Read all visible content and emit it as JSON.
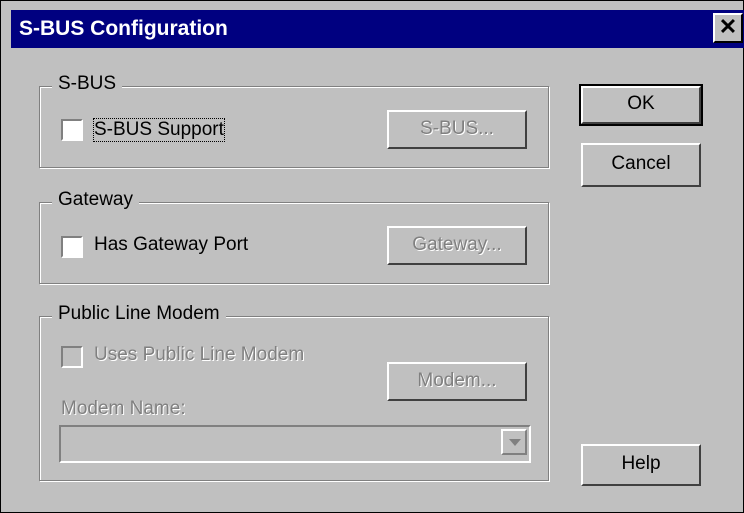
{
  "window": {
    "title": "S-BUS Configuration",
    "close_glyph": "✕"
  },
  "sbus_group": {
    "legend": "S-BUS",
    "checkbox_label": "S-BUS Support",
    "checkbox_checked": false,
    "button_label": "S-BUS..."
  },
  "gateway_group": {
    "legend": "Gateway",
    "checkbox_label": "Has Gateway Port",
    "checkbox_checked": false,
    "button_label": "Gateway..."
  },
  "modem_group": {
    "legend": "Public Line Modem",
    "checkbox_label": "Uses Public Line Modem",
    "checkbox_checked": false,
    "button_label": "Modem...",
    "name_label": "Modem Name:",
    "name_value": ""
  },
  "buttons": {
    "ok": "OK",
    "cancel": "Cancel",
    "help": "Help"
  },
  "colors": {
    "titlebar": "#000080",
    "face": "#c0c0c0",
    "disabled_text": "#808080"
  }
}
